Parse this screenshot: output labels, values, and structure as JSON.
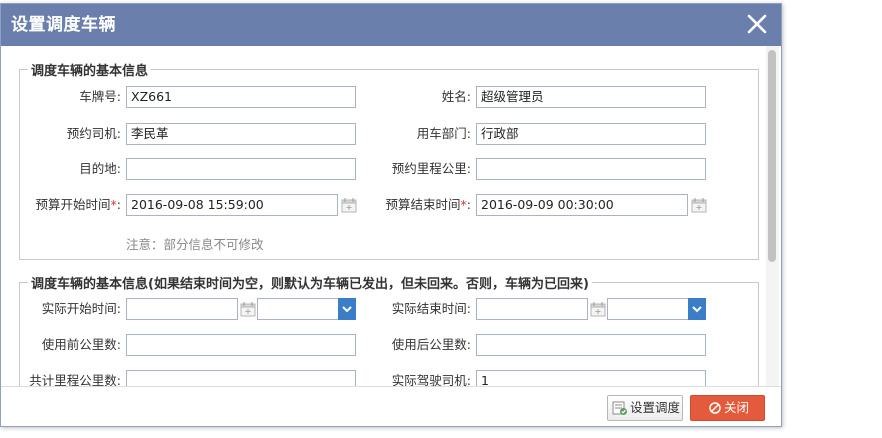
{
  "dialog": {
    "title": "设置调度车辆",
    "close_icon": "close-icon"
  },
  "section1": {
    "legend": "调度车辆的基本信息",
    "fields": {
      "plate": {
        "label": "车牌号:",
        "value": "XZ661"
      },
      "name": {
        "label": "姓名:",
        "value": "超级管理员"
      },
      "driver": {
        "label": "预约司机:",
        "value": "李民革"
      },
      "dept": {
        "label": "用车部门:",
        "value": "行政部"
      },
      "dest": {
        "label": "目的地:",
        "value": ""
      },
      "mileage": {
        "label": "预约里程公里:",
        "value": ""
      },
      "start": {
        "label": "预算开始时间",
        "required": "*",
        "colon": ":",
        "value": "2016-09-08 15:59:00"
      },
      "end": {
        "label": "预算结束时间",
        "required": "*",
        "colon": ":",
        "value": "2016-09-09 00:30:00"
      }
    },
    "note": "注意：部分信息不可修改"
  },
  "section2": {
    "legend": "调度车辆的基本信息(如果结束时间为空，则默认为车辆已发出，但未回来。否则，车辆为已回来)",
    "fields": {
      "actual_start": {
        "label": "实际开始时间:",
        "value": "",
        "select": ""
      },
      "actual_end": {
        "label": "实际结束时间:",
        "value": "",
        "select": ""
      },
      "km_before": {
        "label": "使用前公里数:",
        "value": ""
      },
      "km_after": {
        "label": "使用后公里数:",
        "value": ""
      },
      "km_total": {
        "label": "共计里程公里数:",
        "value": ""
      },
      "actual_driver": {
        "label": "实际驾驶司机:",
        "value": "1"
      }
    }
  },
  "footer": {
    "schedule_label": "设置调度",
    "close_label": "关闭"
  },
  "colors": {
    "titlebar": "#6b7fad",
    "close_button": "#e45a3c",
    "select_button": "#3b7dc7"
  }
}
